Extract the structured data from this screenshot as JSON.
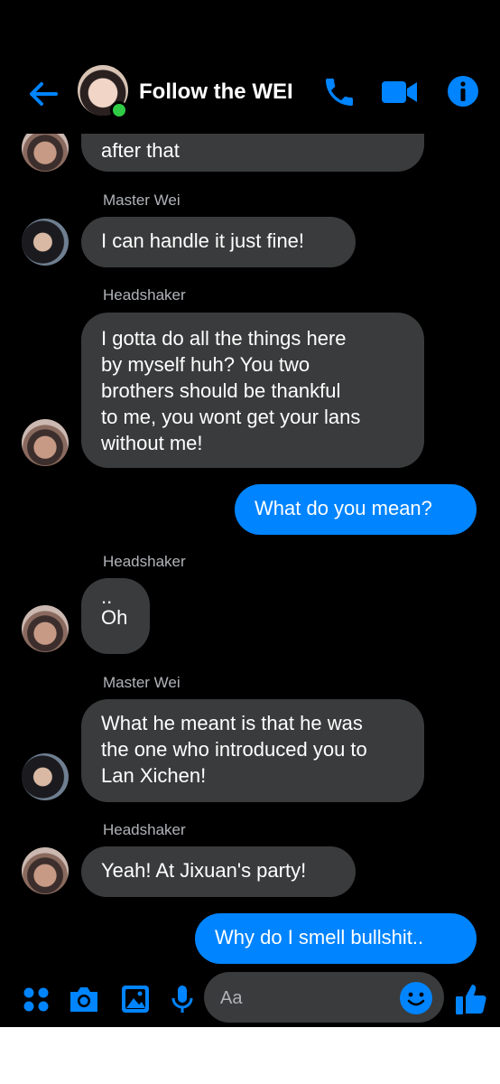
{
  "header": {
    "title": "Follow the WEI",
    "icons": [
      "back-arrow-icon",
      "phone-icon",
      "video-camera-icon",
      "info-icon"
    ],
    "accent_color": "#0084ff",
    "online_color": "#31cc46"
  },
  "messages": [
    {
      "sender": "Headshaker",
      "direction": "incoming",
      "text": "after that"
    },
    {
      "sender": "Master Wei",
      "direction": "incoming",
      "text": "I can handle it just fine!"
    },
    {
      "sender": "Headshaker",
      "direction": "incoming",
      "lines": [
        "I gotta do all the things here",
        "by myself huh? You two",
        "brothers should be thankful",
        "to me, you wont get your lans",
        "without me!"
      ]
    },
    {
      "sender": "me",
      "direction": "outgoing",
      "text": "What do you mean?"
    },
    {
      "sender": "Headshaker",
      "direction": "incoming",
      "lines": [
        "..",
        "Oh"
      ]
    },
    {
      "sender": "Master Wei",
      "direction": "incoming",
      "lines": [
        "What he meant is that he was",
        "the one who introduced you to",
        "Lan Xichen!"
      ]
    },
    {
      "sender": "Headshaker",
      "direction": "incoming",
      "text": "Yeah! At Jixuan's party!"
    },
    {
      "sender": "me",
      "direction": "outgoing",
      "text": "Why do I smell bullshit.."
    }
  ],
  "composer": {
    "placeholder": "Aa",
    "icons": [
      "apps-dots-icon",
      "camera-icon",
      "image-icon",
      "microphone-icon",
      "emoji-icon",
      "thumbs-up-icon"
    ]
  },
  "colors": {
    "incoming_bubble": "#3a3b3c",
    "outgoing_bubble": "#0084ff",
    "name_text": "#b0b3b8"
  }
}
